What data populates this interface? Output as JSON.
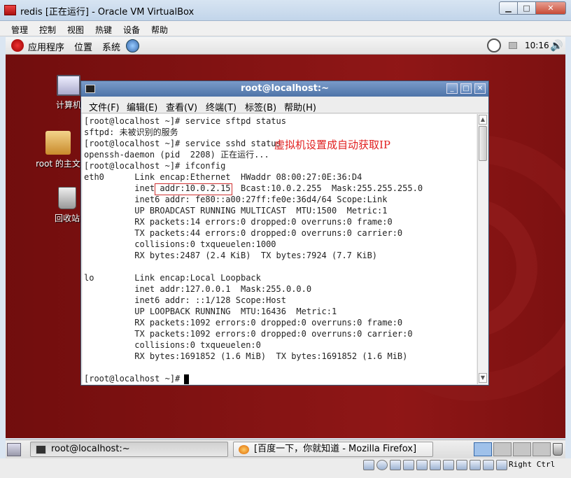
{
  "window": {
    "title": "redis [正在运行] - Oracle VM VirtualBox",
    "controls": {
      "minimize": "▁",
      "maximize": "□",
      "close": "✕"
    }
  },
  "vbox_menu": [
    "管理",
    "控制",
    "视图",
    "热键",
    "设备",
    "帮助"
  ],
  "gnome_panel": {
    "items": [
      "应用程序",
      "位置",
      "系统"
    ],
    "clock": "10:16"
  },
  "desktop_icons": [
    {
      "label": "计算机",
      "icon": "computer-icon"
    },
    {
      "label": "root 的主文",
      "icon": "home-folder-icon"
    },
    {
      "label": "回收站",
      "icon": "trash-icon"
    }
  ],
  "terminal": {
    "title": "root@localhost:~",
    "controls": {
      "minimize": "_",
      "maximize": "□",
      "close": "✕"
    },
    "menu": [
      "文件(F)",
      "编辑(E)",
      "查看(V)",
      "终端(T)",
      "标签(B)",
      "帮助(H)"
    ],
    "annotation": "虚拟机设置成自动获取IP",
    "lines": [
      "[root@localhost ~]# service sftpd status",
      "sftpd: 未被识别的服务",
      "[root@localhost ~]# service sshd status",
      "openssh-daemon (pid  2208) 正在运行...",
      "[root@localhost ~]# ifconfig",
      "eth0      Link encap:Ethernet  HWaddr 08:00:27:0E:36:D4",
      "          inet addr:10.0.2.15  Bcast:10.0.2.255  Mask:255.255.255.0",
      "          inet6 addr: fe80::a00:27ff:fe0e:36d4/64 Scope:Link",
      "          UP BROADCAST RUNNING MULTICAST  MTU:1500  Metric:1",
      "          RX packets:14 errors:0 dropped:0 overruns:0 frame:0",
      "          TX packets:44 errors:0 dropped:0 overruns:0 carrier:0",
      "          collisions:0 txqueuelen:1000",
      "          RX bytes:2487 (2.4 KiB)  TX bytes:7924 (7.7 KiB)",
      "",
      "lo        Link encap:Local Loopback",
      "          inet addr:127.0.0.1  Mask:255.0.0.0",
      "          inet6 addr: ::1/128 Scope:Host",
      "          UP LOOPBACK RUNNING  MTU:16436  Metric:1",
      "          RX packets:1092 errors:0 dropped:0 overruns:0 frame:0",
      "          TX packets:1092 errors:0 dropped:0 overruns:0 carrier:0",
      "          collisions:0 txqueuelen:0",
      "          RX bytes:1691852 (1.6 MiB)  TX bytes:1691852 (1.6 MiB)",
      "",
      "[root@localhost ~]# "
    ]
  },
  "taskbar": {
    "tasks": [
      {
        "label": "root@localhost:~",
        "active": true
      },
      {
        "label": "[百度一下，你就知道 - Mozilla Firefox]",
        "active": false
      }
    ]
  },
  "vbox_status": {
    "host_key": "Right Ctrl"
  }
}
